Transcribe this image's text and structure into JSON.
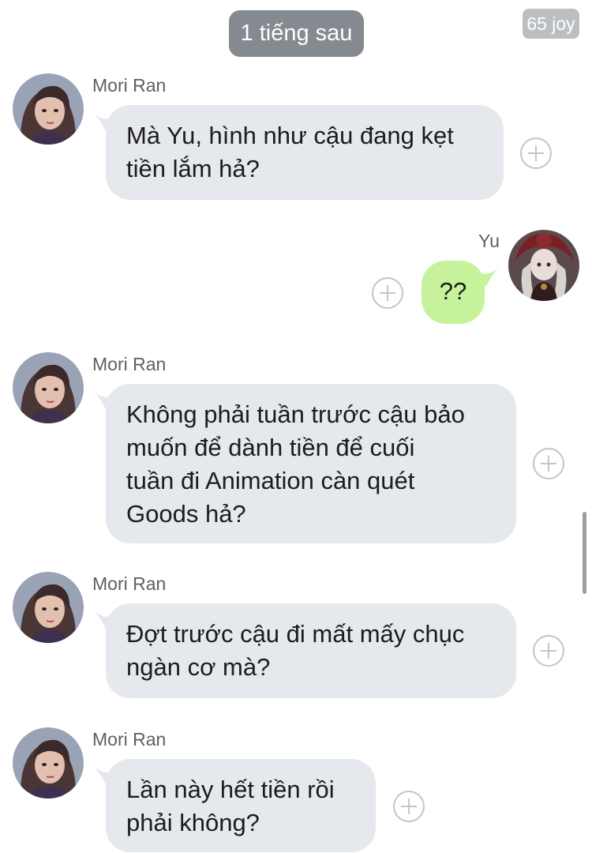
{
  "header": {
    "time_divider": "1 tiếng sau",
    "watermark": "65 joy"
  },
  "participants": {
    "other_name": "Mori Ran",
    "self_name": "Yu"
  },
  "messages": [
    {
      "sender": "Mori Ran",
      "direction": "in",
      "text": "Mà Yu, hình như cậu đang kẹt\ntiền lắm hả?"
    },
    {
      "sender": "Yu",
      "direction": "out",
      "text": "??"
    },
    {
      "sender": "Mori Ran",
      "direction": "in",
      "text": "Không phải tuần trước cậu bảo\nmuốn để dành tiền để cuối\ntuần đi Animation càn quét\nGoods hả?"
    },
    {
      "sender": "Mori Ran",
      "direction": "in",
      "text": "Đợt trước cậu đi mất mấy chục\nngàn cơ mà?"
    },
    {
      "sender": "Mori Ran",
      "direction": "in",
      "text": "Lần này hết tiền rồi\nphải không?"
    }
  ],
  "colors": {
    "incoming_bubble": "#e5e8ec",
    "outgoing_bubble": "#c6f29b",
    "time_pill": "#848a8f"
  }
}
